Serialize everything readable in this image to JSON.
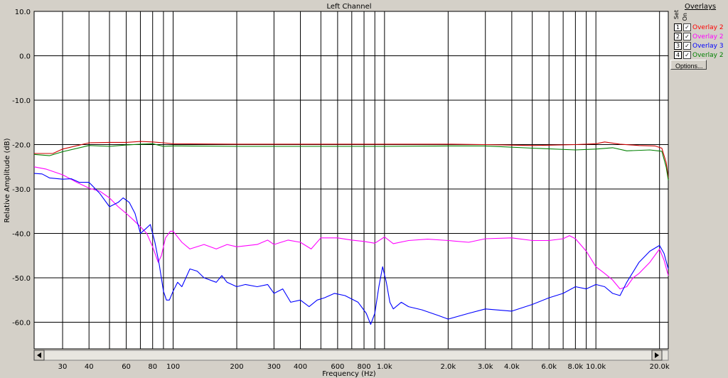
{
  "chart_data": {
    "type": "line",
    "title": "Left Channel",
    "xlabel": "Frequency (Hz)",
    "ylabel": "Relative Amplitude (dB)",
    "xscale": "log",
    "xlim": [
      22,
      22000
    ],
    "ylim": [
      -66,
      10
    ],
    "grid": true,
    "x_ticks": [
      {
        "v": 30,
        "label": "30"
      },
      {
        "v": 40,
        "label": "40"
      },
      {
        "v": 50,
        "label": ""
      },
      {
        "v": 60,
        "label": "60"
      },
      {
        "v": 70,
        "label": ""
      },
      {
        "v": 80,
        "label": "80"
      },
      {
        "v": 90,
        "label": ""
      },
      {
        "v": 100,
        "label": "100"
      },
      {
        "v": 200,
        "label": "200"
      },
      {
        "v": 300,
        "label": "300"
      },
      {
        "v": 400,
        "label": "400"
      },
      {
        "v": 500,
        "label": ""
      },
      {
        "v": 600,
        "label": "600"
      },
      {
        "v": 700,
        "label": ""
      },
      {
        "v": 800,
        "label": "800"
      },
      {
        "v": 900,
        "label": ""
      },
      {
        "v": 1000,
        "label": "1.0k"
      },
      {
        "v": 2000,
        "label": "2.0k"
      },
      {
        "v": 3000,
        "label": "3.0k"
      },
      {
        "v": 4000,
        "label": "4.0k"
      },
      {
        "v": 5000,
        "label": ""
      },
      {
        "v": 6000,
        "label": "6.0k"
      },
      {
        "v": 7000,
        "label": ""
      },
      {
        "v": 8000,
        "label": "8.0k"
      },
      {
        "v": 9000,
        "label": ""
      },
      {
        "v": 10000,
        "label": "10.0k"
      },
      {
        "v": 20000,
        "label": "20.0k"
      }
    ],
    "y_ticks": [
      {
        "v": 10,
        "label": "10.0"
      },
      {
        "v": 0,
        "label": "0.0"
      },
      {
        "v": -10,
        "label": "-10.0"
      },
      {
        "v": -20,
        "label": "-20.0"
      },
      {
        "v": -30,
        "label": "-30.0"
      },
      {
        "v": -40,
        "label": "-40.0"
      },
      {
        "v": -50,
        "label": "-50.0"
      },
      {
        "v": -60,
        "label": "-60.0"
      }
    ],
    "series": [
      {
        "name": "Overlay 2",
        "color": "#cc0000",
        "points": [
          [
            22,
            -22
          ],
          [
            27,
            -22
          ],
          [
            30,
            -21
          ],
          [
            40,
            -19.6
          ],
          [
            50,
            -19.5
          ],
          [
            60,
            -19.5
          ],
          [
            70,
            -19.3
          ],
          [
            80,
            -19.4
          ],
          [
            90,
            -19.6
          ],
          [
            100,
            -19.8
          ],
          [
            200,
            -19.9
          ],
          [
            500,
            -19.9
          ],
          [
            1000,
            -19.9
          ],
          [
            2000,
            -19.9
          ],
          [
            3000,
            -20
          ],
          [
            5000,
            -20.2
          ],
          [
            8000,
            -20
          ],
          [
            10000,
            -19.8
          ],
          [
            11000,
            -19.4
          ],
          [
            13000,
            -19.9
          ],
          [
            16000,
            -20.2
          ],
          [
            19000,
            -20.3
          ],
          [
            20500,
            -20.8
          ],
          [
            21500,
            -24
          ],
          [
            22000,
            -27.5
          ]
        ]
      },
      {
        "name": "Overlay 2",
        "color": "#008000",
        "points": [
          [
            22,
            -22.2
          ],
          [
            26,
            -22.5
          ],
          [
            30,
            -21.6
          ],
          [
            40,
            -20.2
          ],
          [
            50,
            -20.4
          ],
          [
            60,
            -20.1
          ],
          [
            70,
            -19.9
          ],
          [
            80,
            -19.8
          ],
          [
            90,
            -20.4
          ],
          [
            100,
            -20.3
          ],
          [
            200,
            -20.4
          ],
          [
            500,
            -20.4
          ],
          [
            1000,
            -20.4
          ],
          [
            2000,
            -20.3
          ],
          [
            3000,
            -20.3
          ],
          [
            5000,
            -20.8
          ],
          [
            8000,
            -21.2
          ],
          [
            10000,
            -21
          ],
          [
            12000,
            -20.7
          ],
          [
            14000,
            -21.4
          ],
          [
            18000,
            -21.2
          ],
          [
            20500,
            -21.5
          ],
          [
            21500,
            -25
          ],
          [
            22000,
            -28
          ]
        ]
      },
      {
        "name": "Overlay 2",
        "color": "#ff00ff",
        "points": [
          [
            22,
            -25
          ],
          [
            25,
            -25.5
          ],
          [
            30,
            -26.8
          ],
          [
            35,
            -28.5
          ],
          [
            40,
            -29.8
          ],
          [
            45,
            -30.5
          ],
          [
            50,
            -32
          ],
          [
            55,
            -34
          ],
          [
            60,
            -35.5
          ],
          [
            65,
            -37
          ],
          [
            70,
            -38.5
          ],
          [
            75,
            -40
          ],
          [
            80,
            -43
          ],
          [
            85,
            -46.5
          ],
          [
            88,
            -45
          ],
          [
            92,
            -41
          ],
          [
            97,
            -39.5
          ],
          [
            100,
            -39.5
          ],
          [
            110,
            -42
          ],
          [
            120,
            -43.5
          ],
          [
            140,
            -42.5
          ],
          [
            160,
            -43.5
          ],
          [
            180,
            -42.5
          ],
          [
            200,
            -43
          ],
          [
            250,
            -42.5
          ],
          [
            280,
            -41.5
          ],
          [
            300,
            -42.5
          ],
          [
            350,
            -41.5
          ],
          [
            400,
            -42
          ],
          [
            450,
            -43.5
          ],
          [
            500,
            -41
          ],
          [
            600,
            -41
          ],
          [
            700,
            -41.5
          ],
          [
            800,
            -41.8
          ],
          [
            900,
            -42.2
          ],
          [
            1000,
            -40.8
          ],
          [
            1100,
            -42.3
          ],
          [
            1300,
            -41.6
          ],
          [
            1600,
            -41.3
          ],
          [
            2000,
            -41.6
          ],
          [
            2500,
            -42
          ],
          [
            3000,
            -41.2
          ],
          [
            4000,
            -41
          ],
          [
            5000,
            -41.6
          ],
          [
            6000,
            -41.6
          ],
          [
            7000,
            -41.2
          ],
          [
            7500,
            -40.5
          ],
          [
            8000,
            -41.2
          ],
          [
            9000,
            -44
          ],
          [
            10000,
            -47.5
          ],
          [
            11000,
            -49
          ],
          [
            12000,
            -50.5
          ],
          [
            13000,
            -52.5
          ],
          [
            14000,
            -52
          ],
          [
            15000,
            -50
          ],
          [
            16000,
            -49
          ],
          [
            18000,
            -46.5
          ],
          [
            20000,
            -43.5
          ],
          [
            21000,
            -46
          ],
          [
            22000,
            -49.5
          ]
        ]
      },
      {
        "name": "Overlay 3",
        "color": "#0000ff",
        "points": [
          [
            22,
            -26.5
          ],
          [
            24,
            -26.6
          ],
          [
            26,
            -27.5
          ],
          [
            30,
            -27.8
          ],
          [
            33,
            -27.7
          ],
          [
            36,
            -28.5
          ],
          [
            40,
            -28.5
          ],
          [
            45,
            -31
          ],
          [
            50,
            -34
          ],
          [
            55,
            -33
          ],
          [
            58,
            -32
          ],
          [
            62,
            -33
          ],
          [
            66,
            -35.5
          ],
          [
            70,
            -40
          ],
          [
            74,
            -39
          ],
          [
            78,
            -38
          ],
          [
            82,
            -42
          ],
          [
            86,
            -47
          ],
          [
            90,
            -53
          ],
          [
            93,
            -55
          ],
          [
            96,
            -55
          ],
          [
            100,
            -53
          ],
          [
            105,
            -51
          ],
          [
            110,
            -52
          ],
          [
            120,
            -48
          ],
          [
            130,
            -48.5
          ],
          [
            140,
            -50
          ],
          [
            160,
            -51
          ],
          [
            170,
            -49.5
          ],
          [
            180,
            -51
          ],
          [
            200,
            -52
          ],
          [
            220,
            -51.5
          ],
          [
            250,
            -52
          ],
          [
            280,
            -51.5
          ],
          [
            300,
            -53.5
          ],
          [
            330,
            -52.5
          ],
          [
            360,
            -55.5
          ],
          [
            400,
            -55
          ],
          [
            440,
            -56.5
          ],
          [
            480,
            -55
          ],
          [
            520,
            -54.5
          ],
          [
            580,
            -53.5
          ],
          [
            650,
            -54
          ],
          [
            750,
            -55.5
          ],
          [
            820,
            -58
          ],
          [
            860,
            -60.5
          ],
          [
            900,
            -58
          ],
          [
            940,
            -52
          ],
          [
            980,
            -47.5
          ],
          [
            1020,
            -51
          ],
          [
            1060,
            -55.5
          ],
          [
            1100,
            -57
          ],
          [
            1200,
            -55.5
          ],
          [
            1300,
            -56.5
          ],
          [
            1500,
            -57.2
          ],
          [
            1800,
            -58.5
          ],
          [
            2000,
            -59.3
          ],
          [
            2500,
            -58
          ],
          [
            3000,
            -57
          ],
          [
            4000,
            -57.5
          ],
          [
            5000,
            -56
          ],
          [
            6000,
            -54.5
          ],
          [
            7000,
            -53.5
          ],
          [
            8000,
            -52
          ],
          [
            9000,
            -52.5
          ],
          [
            10000,
            -51.5
          ],
          [
            11000,
            -52
          ],
          [
            12000,
            -53.5
          ],
          [
            13000,
            -54
          ],
          [
            14000,
            -51
          ],
          [
            16000,
            -46.5
          ],
          [
            18000,
            -44
          ],
          [
            20000,
            -42.7
          ],
          [
            21000,
            -44.5
          ],
          [
            22000,
            -48
          ]
        ]
      }
    ]
  },
  "panel": {
    "title": "Overlays",
    "col_set": "Set",
    "col_on": "On",
    "check": "✓",
    "options_label": "Options...",
    "rows": [
      {
        "num": "1",
        "name": "Overlay 2",
        "color": "#ff0000"
      },
      {
        "num": "2",
        "name": "Overlay 2",
        "color": "#ff00ff"
      },
      {
        "num": "3",
        "name": "Overlay 3",
        "color": "#0000ff"
      },
      {
        "num": "4",
        "name": "Overlay 2",
        "color": "#008000"
      }
    ]
  }
}
